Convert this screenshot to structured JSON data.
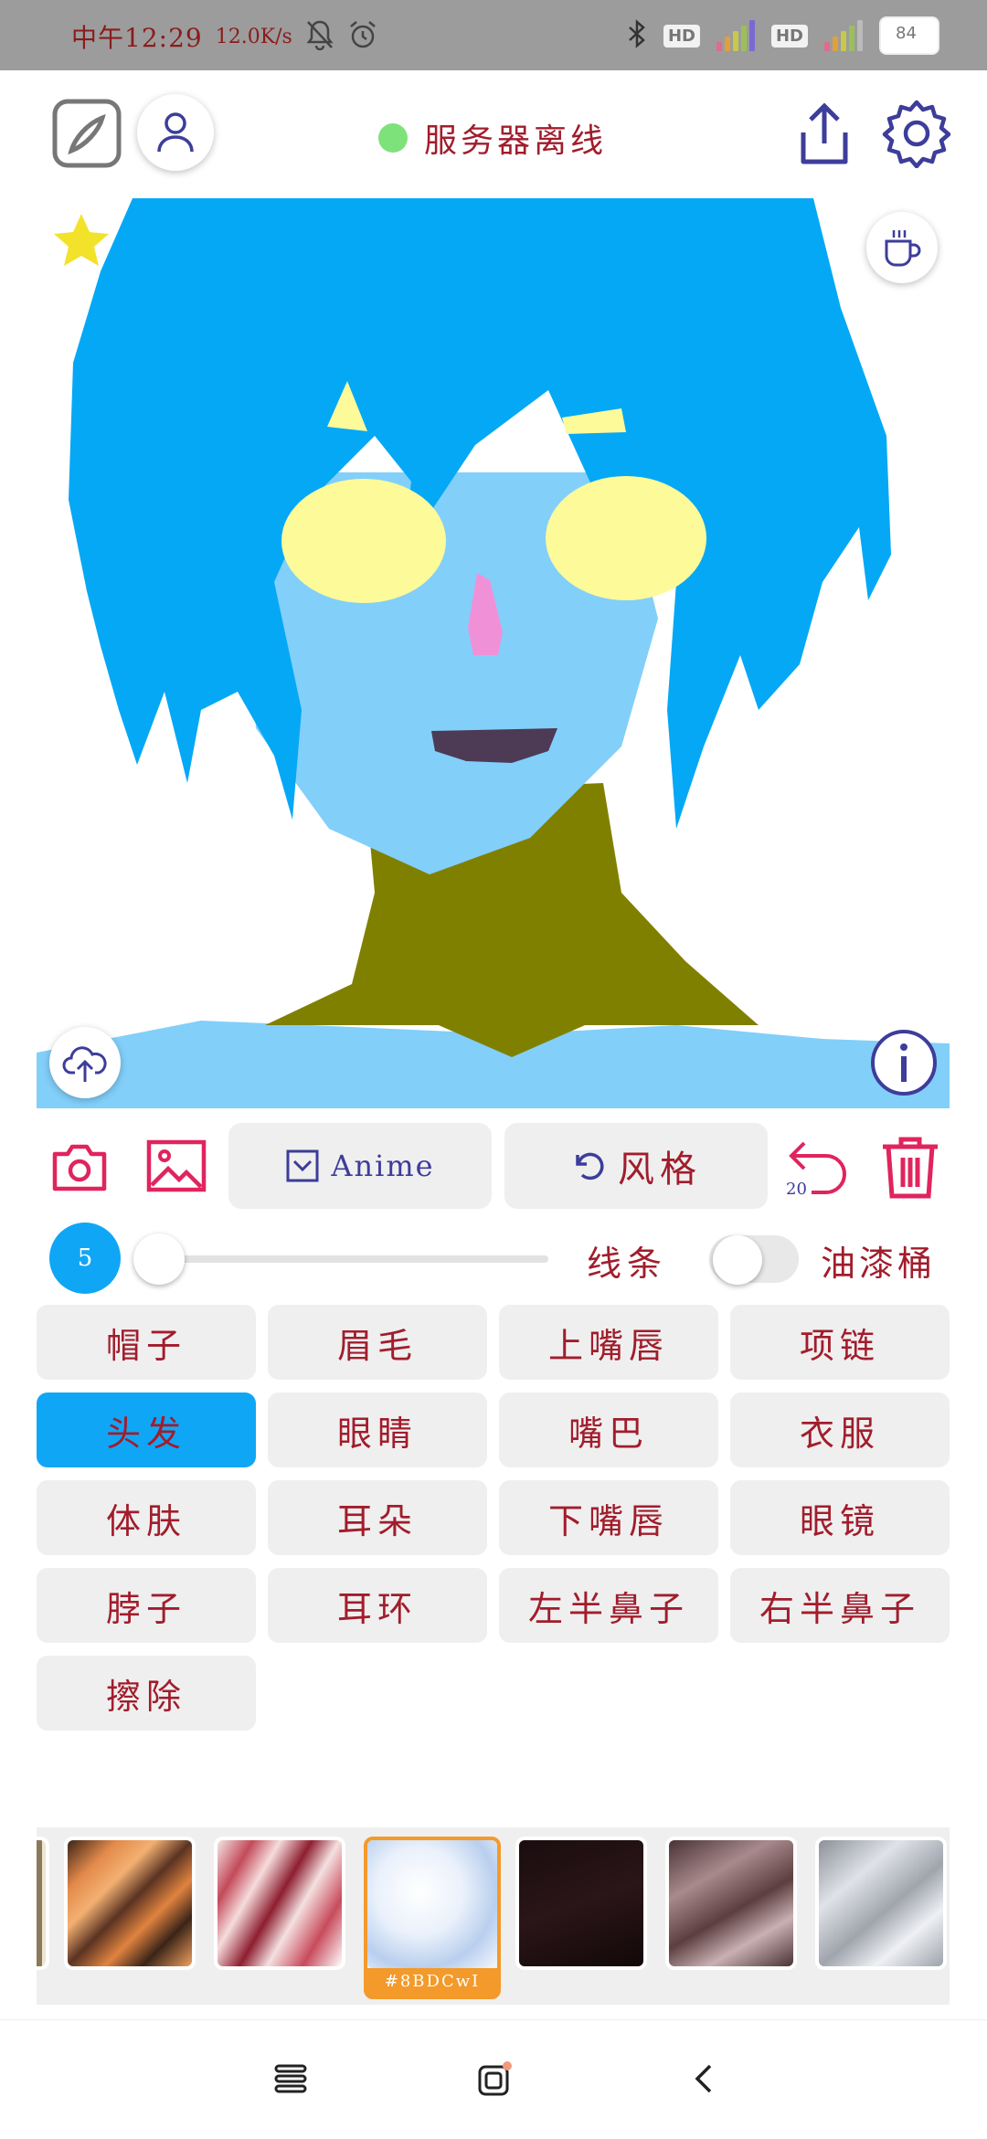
{
  "status_bar": {
    "time": "中午12:29",
    "net_speed": "12.0K/s",
    "hd1": "HD",
    "hd2": "HD",
    "battery_level": "84"
  },
  "header": {
    "server_status": "服务器离线",
    "status_color": "#7ee27a"
  },
  "toolbar": {
    "anime_label": "Anime",
    "style_label": "风格",
    "undo_count": "20"
  },
  "brush": {
    "size": "5",
    "slider_fraction": 0.0,
    "line_label": "线条",
    "bucket_label": "油漆桶",
    "bucket_enabled": false
  },
  "parts": [
    {
      "label": "帽子",
      "active": false
    },
    {
      "label": "眉毛",
      "active": false
    },
    {
      "label": "上嘴唇",
      "active": false
    },
    {
      "label": "项链",
      "active": false
    },
    {
      "label": "头发",
      "active": true
    },
    {
      "label": "眼睛",
      "active": false
    },
    {
      "label": "嘴巴",
      "active": false
    },
    {
      "label": "衣服",
      "active": false
    },
    {
      "label": "体肤",
      "active": false
    },
    {
      "label": "耳朵",
      "active": false
    },
    {
      "label": "下嘴唇",
      "active": false
    },
    {
      "label": "眼镜",
      "active": false
    },
    {
      "label": "脖子",
      "active": false
    },
    {
      "label": "耳环",
      "active": false
    },
    {
      "label": "左半鼻子",
      "active": false
    },
    {
      "label": "右半鼻子",
      "active": false
    },
    {
      "label": "擦除",
      "active": false
    }
  ],
  "textures": {
    "selected_caption": "#8BDCwI"
  },
  "colors": {
    "accent": "#10a6f6",
    "label_red": "#a11d2c",
    "icon_purple": "#3d3d9a",
    "icon_pink": "#e0245e",
    "hair": "#05a8f5",
    "skin": "#82cffa",
    "eyes": "#fdfa9a",
    "nose": "#f091d8",
    "mouth": "#4d3a55",
    "neck": "#808000"
  }
}
